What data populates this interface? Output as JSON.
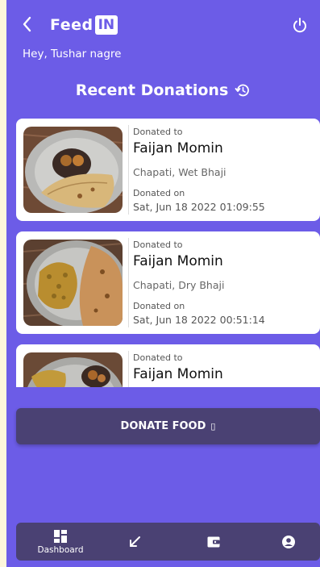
{
  "header": {
    "back_icon": "chevron-left-icon",
    "logo_text": "Feed",
    "logo_box": "IN",
    "power_icon": "power-icon"
  },
  "greeting": "Hey, Tushar nagre",
  "section": {
    "title": "Recent Donations",
    "icon": "history-icon"
  },
  "donations": [
    {
      "donated_to_label": "Donated to",
      "name": "Faijan Momin",
      "items": "Chapati, Wet Bhaji",
      "donated_on_label": "Donated on",
      "date": "Sat, Jun 18 2022 01:09:55"
    },
    {
      "donated_to_label": "Donated to",
      "name": "Faijan Momin",
      "items": "Chapati, Dry Bhaji",
      "donated_on_label": "Donated on",
      "date": "Sat, Jun 18 2022 00:51:14"
    },
    {
      "donated_to_label": "Donated to",
      "name": "Faijan Momin"
    }
  ],
  "donate_button": {
    "label": "DONATE FOOD",
    "icon_glyph": "▯"
  },
  "bottom_nav": {
    "dashboard_label": "Dashboard",
    "icons": [
      "dashboard-icon",
      "arrow-down-left-icon",
      "wallet-icon",
      "account-icon"
    ]
  },
  "colors": {
    "background": "#6c5ce7",
    "card": "#ffffff",
    "dark_bar": "#4a4173",
    "outer": "#fdf6dc"
  }
}
